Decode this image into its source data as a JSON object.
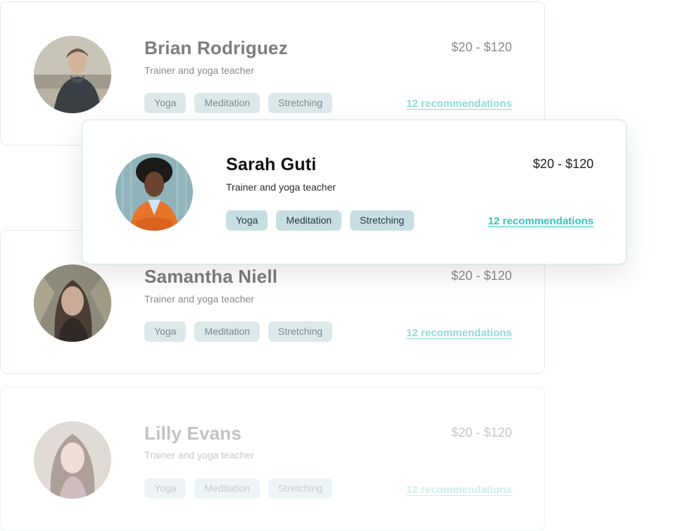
{
  "cards": [
    {
      "name": "Brian Rodriguez",
      "role": "Trainer and yoga teacher",
      "price": "$20 - $120",
      "tags": [
        "Yoga",
        "Meditation",
        "Stretching"
      ],
      "recommendations": "12 recommendations",
      "avatar": "brian-photo"
    },
    {
      "name": "Sarah Guti",
      "role": "Trainer and yoga teacher",
      "price": "$20 - $120",
      "tags": [
        "Yoga",
        "Meditation",
        "Stretching"
      ],
      "recommendations": "12 recommendations",
      "avatar": "sarah-photo"
    },
    {
      "name": "Samantha Niell",
      "role": "Trainer and yoga teacher",
      "price": "$20 - $120",
      "tags": [
        "Yoga",
        "Meditation",
        "Stretching"
      ],
      "recommendations": "12 recommendations",
      "avatar": "samantha-photo"
    },
    {
      "name": "Lilly Evans",
      "role": "Trainer and yoga teacher",
      "price": "$20 - $120",
      "tags": [
        "Yoga",
        "Meditation",
        "Stretching"
      ],
      "recommendations": "12 recommendations",
      "avatar": "lilly-photo"
    }
  ],
  "colors": {
    "accent": "#2fc9bd",
    "tag_bg": "#c7dfe3",
    "card_border": "#cfe4e1"
  }
}
